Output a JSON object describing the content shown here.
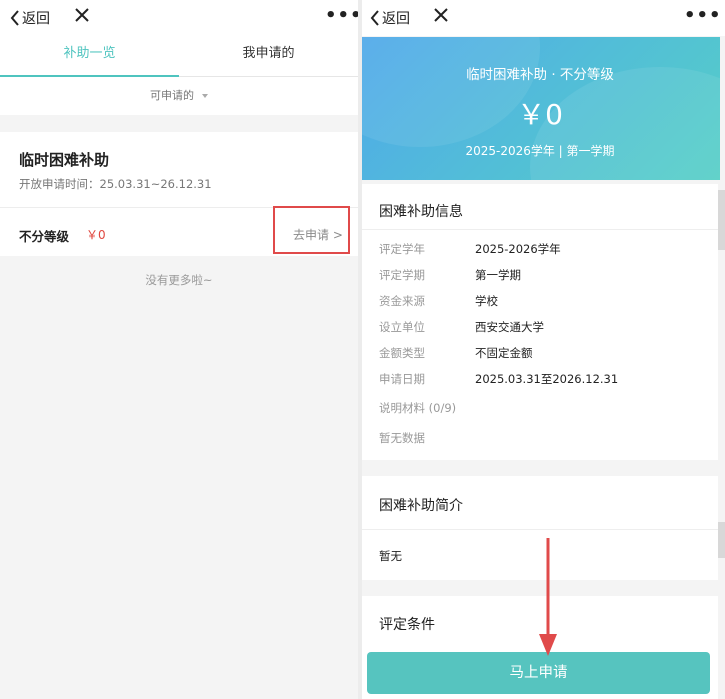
{
  "left": {
    "nav": {
      "back": "返回"
    },
    "tabs": [
      "补助一览",
      "我申请的"
    ],
    "filter": "可申请的",
    "card": {
      "title": "临时困难补助",
      "time": "开放申请时间：25.03.31~26.12.31",
      "level": "不分等级",
      "amount": "￥0",
      "apply": "去申请 >"
    },
    "no_more": "没有更多啦~"
  },
  "right": {
    "nav": {
      "back": "返回"
    },
    "banner": {
      "title": "临时困难补助 · 不分等级",
      "amount": "￥0",
      "term": "2025-2026学年 | 第一学期"
    },
    "info": {
      "title": "困难补助信息",
      "rows": [
        {
          "label": "评定学年",
          "value": "2025-2026学年"
        },
        {
          "label": "评定学期",
          "value": "第一学期"
        },
        {
          "label": "资金来源",
          "value": "学校"
        },
        {
          "label": "设立单位",
          "value": "西安交通大学"
        },
        {
          "label": "金额类型",
          "value": "不固定金额"
        },
        {
          "label": "申请日期",
          "value": "2025.03.31至2026.12.31"
        }
      ],
      "materials": "说明材料 (0/9)",
      "no_data": "暂无数据"
    },
    "intro": {
      "title": "困难补助简介",
      "content": "暂无"
    },
    "criteria": {
      "title": "评定条件"
    },
    "button": "马上申请"
  },
  "colors": {
    "accent": "#4fc4bf",
    "highlight": "#e04a4a",
    "price": "#e0473f"
  },
  "icons": [
    "chevron-left-icon",
    "close-icon",
    "more-dots-icon",
    "dropdown-caret-icon",
    "arrow-down-icon"
  ]
}
